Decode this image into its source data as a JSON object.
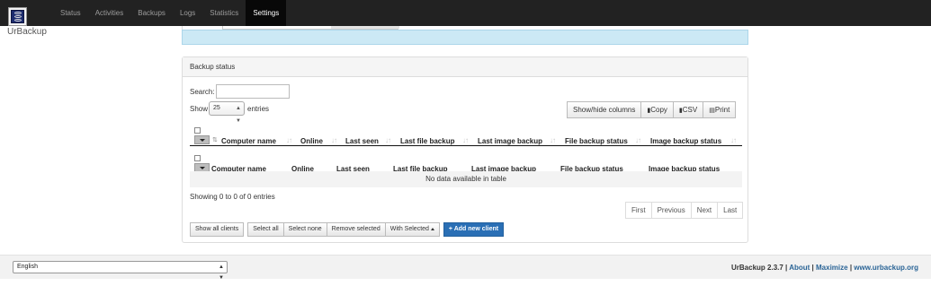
{
  "app": {
    "brand": "UrBackup"
  },
  "nav": {
    "items": [
      {
        "label": "Status"
      },
      {
        "label": "Activities"
      },
      {
        "label": "Backups"
      },
      {
        "label": "Logs"
      },
      {
        "label": "Statistics"
      },
      {
        "label": "Settings",
        "active": true
      }
    ]
  },
  "panel": {
    "title": "Backup status",
    "search_label": "Search:",
    "search_value": "",
    "show_label": "Show",
    "entries_length": "25",
    "entries_label": "entries",
    "buttons": {
      "show_hide": "Show/hide columns",
      "copy": "Copy",
      "csv": "CSV",
      "print": "Print"
    },
    "columns": [
      "Computer name",
      "Online",
      "Last seen",
      "Last file backup",
      "Last image backup",
      "File backup status",
      "Image backup status"
    ],
    "empty_message": "No data available in table",
    "info": "Showing 0 to 0 of 0 entries",
    "pager": {
      "first": "First",
      "previous": "Previous",
      "next": "Next",
      "last": "Last"
    },
    "actions": {
      "show_all": "Show all clients",
      "select_all": "Select all",
      "select_none": "Select none",
      "remove_selected": "Remove selected",
      "with_selected": "With Selected",
      "add_client": "+ Add new client"
    }
  },
  "footer": {
    "language": "English",
    "version": "UrBackup 2.3.7",
    "about": "About",
    "maximize": "Maximize",
    "website": "www.urbackup.org"
  },
  "colors": {
    "navbar": "#222222",
    "info_bar": "#cce9f5",
    "primary_button": "#2a6fb5",
    "link": "#2a6496"
  }
}
